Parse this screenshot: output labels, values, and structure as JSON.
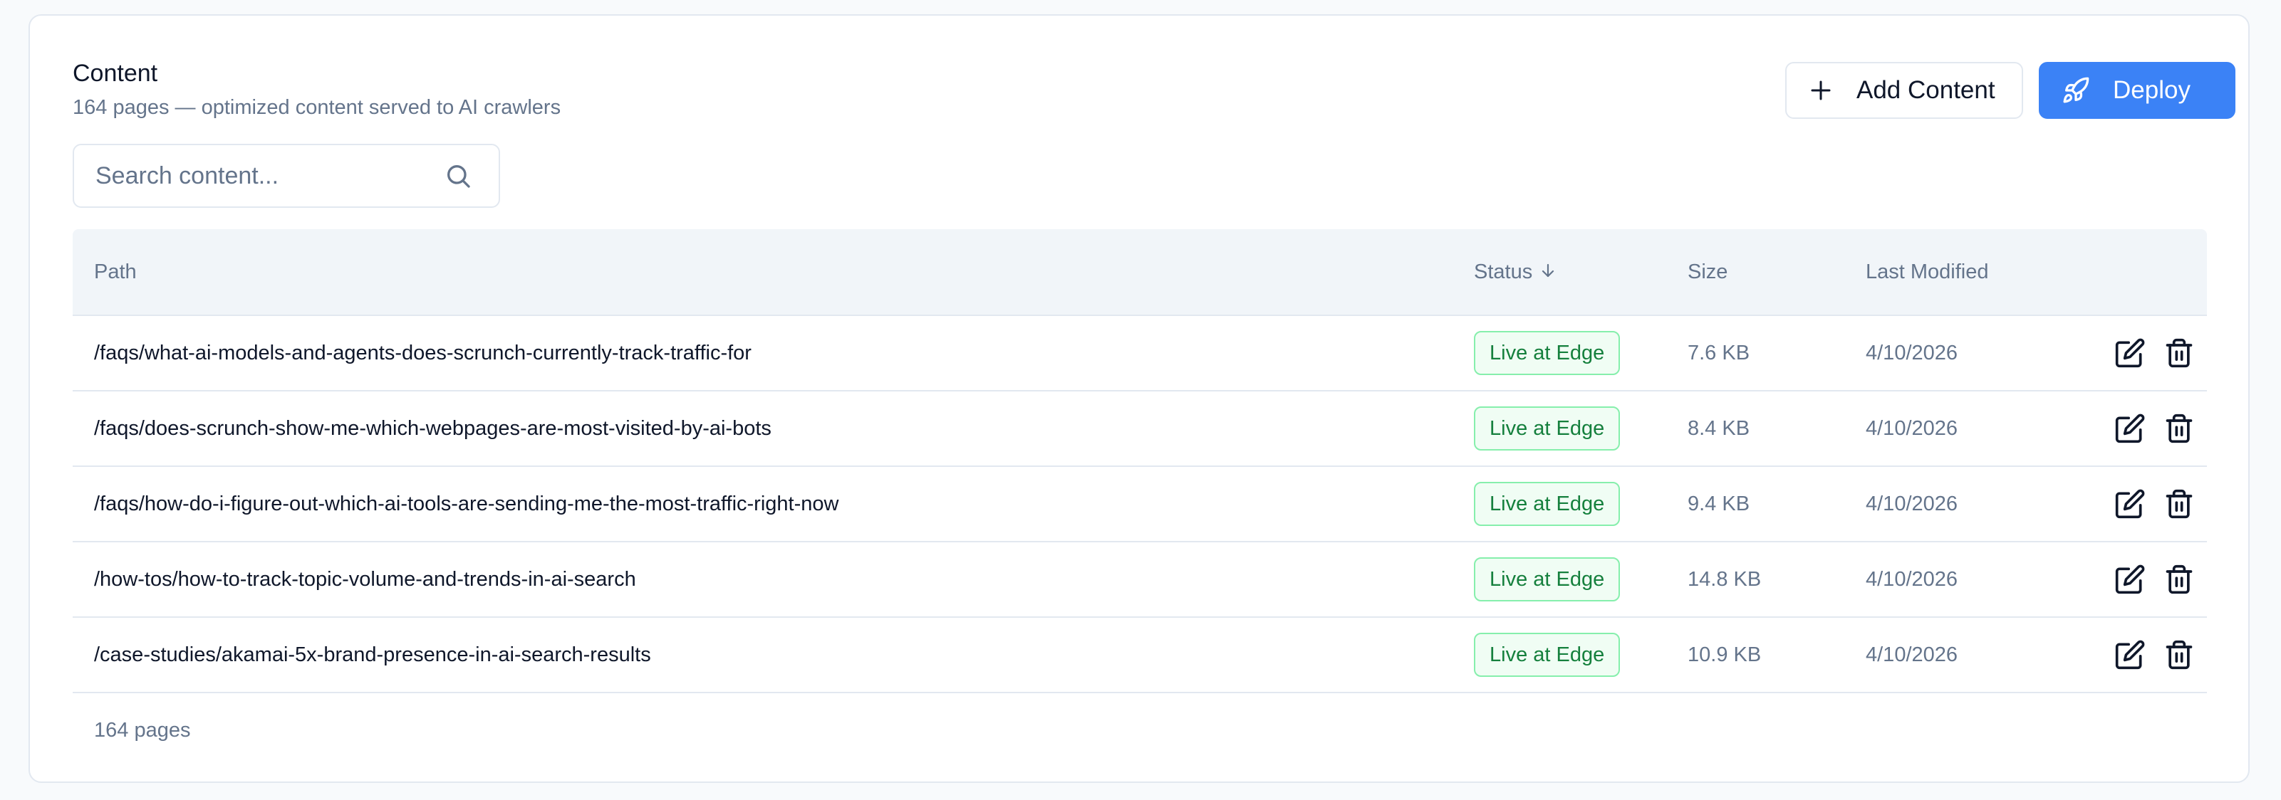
{
  "header": {
    "title": "Content",
    "subtitle": "164 pages — optimized content served to AI crawlers"
  },
  "actions": {
    "add_label": "Add Content",
    "deploy_label": "Deploy",
    "add_icon": "plus-icon",
    "deploy_icon": "rocket-icon"
  },
  "search": {
    "placeholder": "Search content...",
    "value": "",
    "icon": "search-icon"
  },
  "table": {
    "columns": {
      "path": "Path",
      "status": "Status",
      "size": "Size",
      "modified": "Last Modified"
    },
    "sort": {
      "column": "status",
      "direction": "descending",
      "icon": "arrow-down-icon"
    },
    "rows": [
      {
        "path": "/faqs/what-ai-models-and-agents-does-scrunch-currently-track-traffic-for",
        "status": "Live at Edge",
        "size": "7.6 KB",
        "modified": "4/10/2026"
      },
      {
        "path": "/faqs/does-scrunch-show-me-which-webpages-are-most-visited-by-ai-bots",
        "status": "Live at Edge",
        "size": "8.4 KB",
        "modified": "4/10/2026"
      },
      {
        "path": "/faqs/how-do-i-figure-out-which-ai-tools-are-sending-me-the-most-traffic-right-now",
        "status": "Live at Edge",
        "size": "9.4 KB",
        "modified": "4/10/2026"
      },
      {
        "path": "/how-tos/how-to-track-topic-volume-and-trends-in-ai-search",
        "status": "Live at Edge",
        "size": "14.8 KB",
        "modified": "4/10/2026"
      },
      {
        "path": "/case-studies/akamai-5x-brand-presence-in-ai-search-results",
        "status": "Live at Edge",
        "size": "10.9 KB",
        "modified": "4/10/2026"
      }
    ],
    "row_icons": [
      "edit-icon",
      "trash-icon"
    ]
  },
  "footer": {
    "count": "164 pages"
  },
  "colors": {
    "accent": "#3b82f6",
    "status_text": "#15803d",
    "status_border": "#86efac",
    "status_bg": "#f0fdf4",
    "muted": "#64748b"
  }
}
